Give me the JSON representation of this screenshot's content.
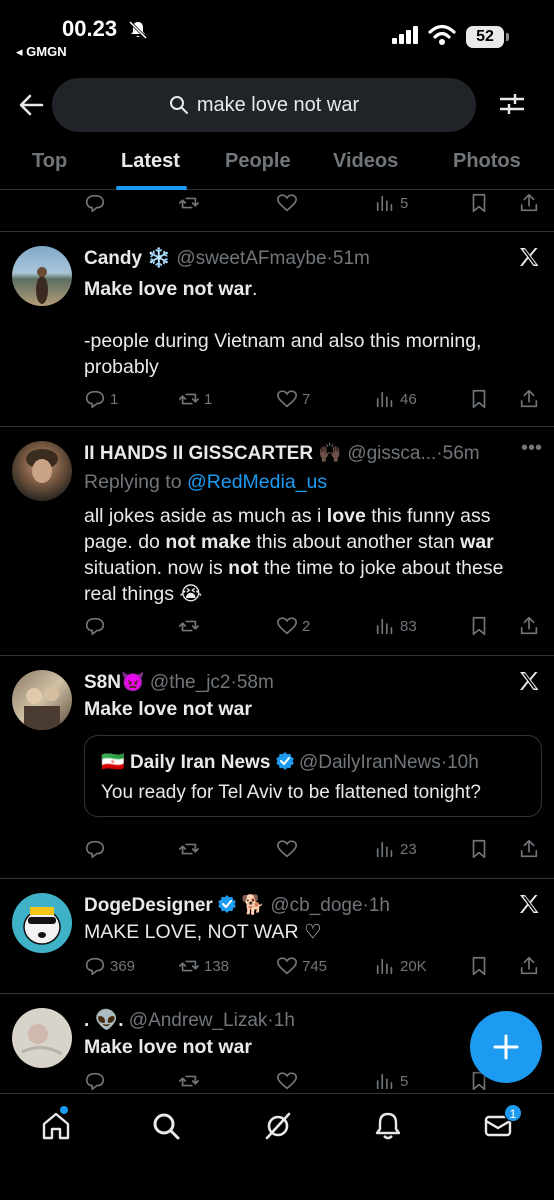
{
  "status_bar": {
    "time": "00.23",
    "back_app": "◂ GMGN",
    "battery": "52"
  },
  "search": {
    "query": "make love not war"
  },
  "tabs": [
    "Top",
    "Latest",
    "People",
    "Videos",
    "Photos"
  ],
  "partial_tweet": {
    "views": "5"
  },
  "tweets": [
    {
      "name": "Candy",
      "emoji": "❄️",
      "handle": "@sweetAFmaybe",
      "time": "51m",
      "text_line1_bold": "Make love not war",
      "text_line1_rest": ".",
      "text_para2": "-people during Vietnam and also this morning, probably",
      "replies": "1",
      "reposts": "1",
      "likes": "7",
      "views": "46"
    },
    {
      "name": "II HANDS II GISSCARTER",
      "emoji": "🙌🏿",
      "handle": "@gissca...",
      "time": "56m",
      "replying_label": "Replying to",
      "replying_handle": "@RedMedia_us",
      "text": {
        "p1": "all jokes aside as much as i ",
        "p2": "love",
        "p3": " this funny ass page. do ",
        "p4": "not make",
        "p5": " this about another stan ",
        "p6": "war",
        "p7": " situation. now is ",
        "p8": "not",
        "p9": " the time to joke about these real things 😭"
      },
      "replies": "",
      "reposts": "",
      "likes": "2",
      "views": "83"
    },
    {
      "name": "S8N",
      "emoji": "👿",
      "handle": "@the_jc2",
      "time": "58m",
      "text": "Make love not war",
      "quote": {
        "flag": "🇮🇷",
        "name": "Daily Iran News",
        "handle": "@DailyIranNews",
        "time": "10h",
        "text": "You ready for Tel Aviv to be flattened tonight?"
      },
      "replies": "",
      "reposts": "",
      "likes": "",
      "views": "23"
    },
    {
      "name": "DogeDesigner",
      "emoji": "🐕",
      "handle": "@cb_doge",
      "time": "1h",
      "text": "MAKE LOVE, NOT WAR ♡",
      "replies": "369",
      "reposts": "138",
      "likes": "745",
      "views": "20K"
    },
    {
      "name": ". 👽.",
      "handle": "@Andrew_Lizak",
      "time": "1h",
      "text": "Make love not war",
      "views": "5"
    }
  ],
  "nav": {
    "messages_badge": "1"
  },
  "colors": {
    "accent": "#1d9bf0",
    "muted": "#71767b",
    "divider": "#2f3336",
    "background": "#000000"
  }
}
